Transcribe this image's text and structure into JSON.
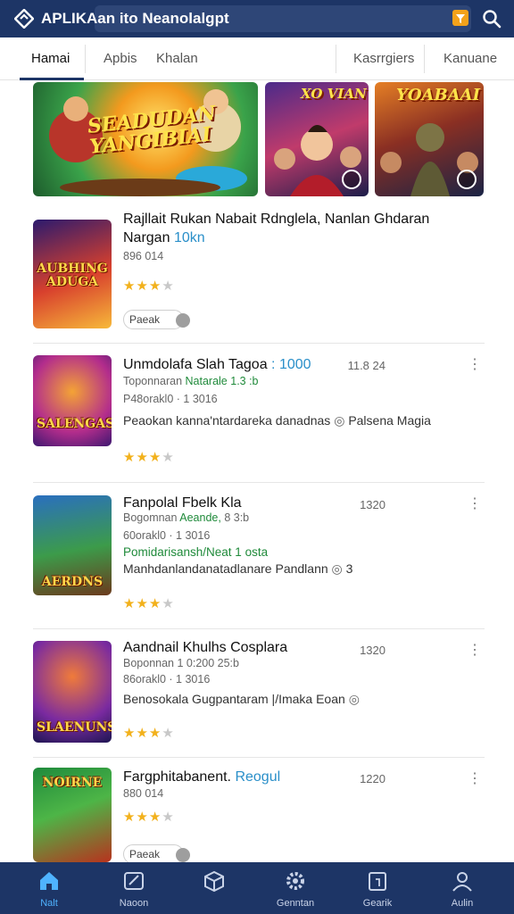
{
  "header": {
    "app_title": "APLIKAan ito Neanolalgpt",
    "search_placeholder": "",
    "filter_icon": "filter-icon",
    "search_icon": "search-icon"
  },
  "tabs": [
    "Hamai",
    "Apbis",
    "Khalan",
    "Kasrrgiers",
    "Kanuane"
  ],
  "active_tab": 0,
  "banners": [
    {
      "title": "SEADUDAN YANGIBIAI",
      "icon": "play-icon"
    },
    {
      "title": "XO VIAN",
      "icon": "play-icon"
    },
    {
      "title": "YOABAAI",
      "icon": "play-icon"
    }
  ],
  "items": [
    {
      "title": "Rajllait Rukan Nabait Rdnglela, Nanlan Ghdaran",
      "title2": "Nargan",
      "title_accent": "10kn",
      "meta": "896 014",
      "rating": 2.5,
      "chip": "Paeak",
      "thumb_label": "AUBHING ADUGA"
    },
    {
      "title": "Unmdolafa Slah Tagoa",
      "title_accent": ": 1000",
      "date": "11.8 24",
      "meta1": "Toponnaran",
      "meta1_green": "Natarale 1.3 :b",
      "meta2": "P48orakl0 · 1 3016",
      "desc": "Peaokan kanna'ntardareka danadnas",
      "desc_link": "Palsena Magia",
      "rating": 3,
      "thumb_label": "SALENGAS"
    },
    {
      "title": "Fanpolal Fbelk Kla",
      "date": "1320",
      "meta1": "Bogomnan",
      "meta1_green": "Aeande,",
      "meta1_tail": "8 3:b",
      "meta2": "60orakl0 · 1 3016",
      "green_line": "Pomidarisansh/Neat 1 osta",
      "desc": "Manhdanlandanatadlanare Pandlann",
      "desc_tail": "3",
      "rating": 3,
      "thumb_label": "AERDNS"
    },
    {
      "title": "Aandnail Khulhs Cosplara",
      "date": "1320",
      "meta1": "Boponnan 1 0:200 25:b",
      "meta2": "86orakl0 · 1 3016",
      "desc": "Benosokala Gugpantaram |/Imaka Eoan",
      "rating": 3,
      "thumb_label": "SLAENUNS"
    },
    {
      "title": "Fargphitabanent.",
      "title_accent": "Reogul",
      "date": "1220",
      "meta": "880 014",
      "rating": 3,
      "chip": "Paeak",
      "thumb_label": "NOIRNE"
    }
  ],
  "bottom_nav": [
    {
      "label": "Nalt",
      "icon": "home-icon"
    },
    {
      "label": "Naoon",
      "icon": "edit-icon"
    },
    {
      "label": "",
      "icon": "box-icon"
    },
    {
      "label": "Genntan",
      "icon": "gear-icon"
    },
    {
      "label": "Gearik",
      "icon": "calendar-icon"
    },
    {
      "label": "Aulin",
      "icon": "person-icon"
    }
  ],
  "colors": {
    "brand": "#1d3566",
    "accent": "#2a8fc9",
    "star": "#f2b11c",
    "active_nav": "#4fb3ff"
  }
}
